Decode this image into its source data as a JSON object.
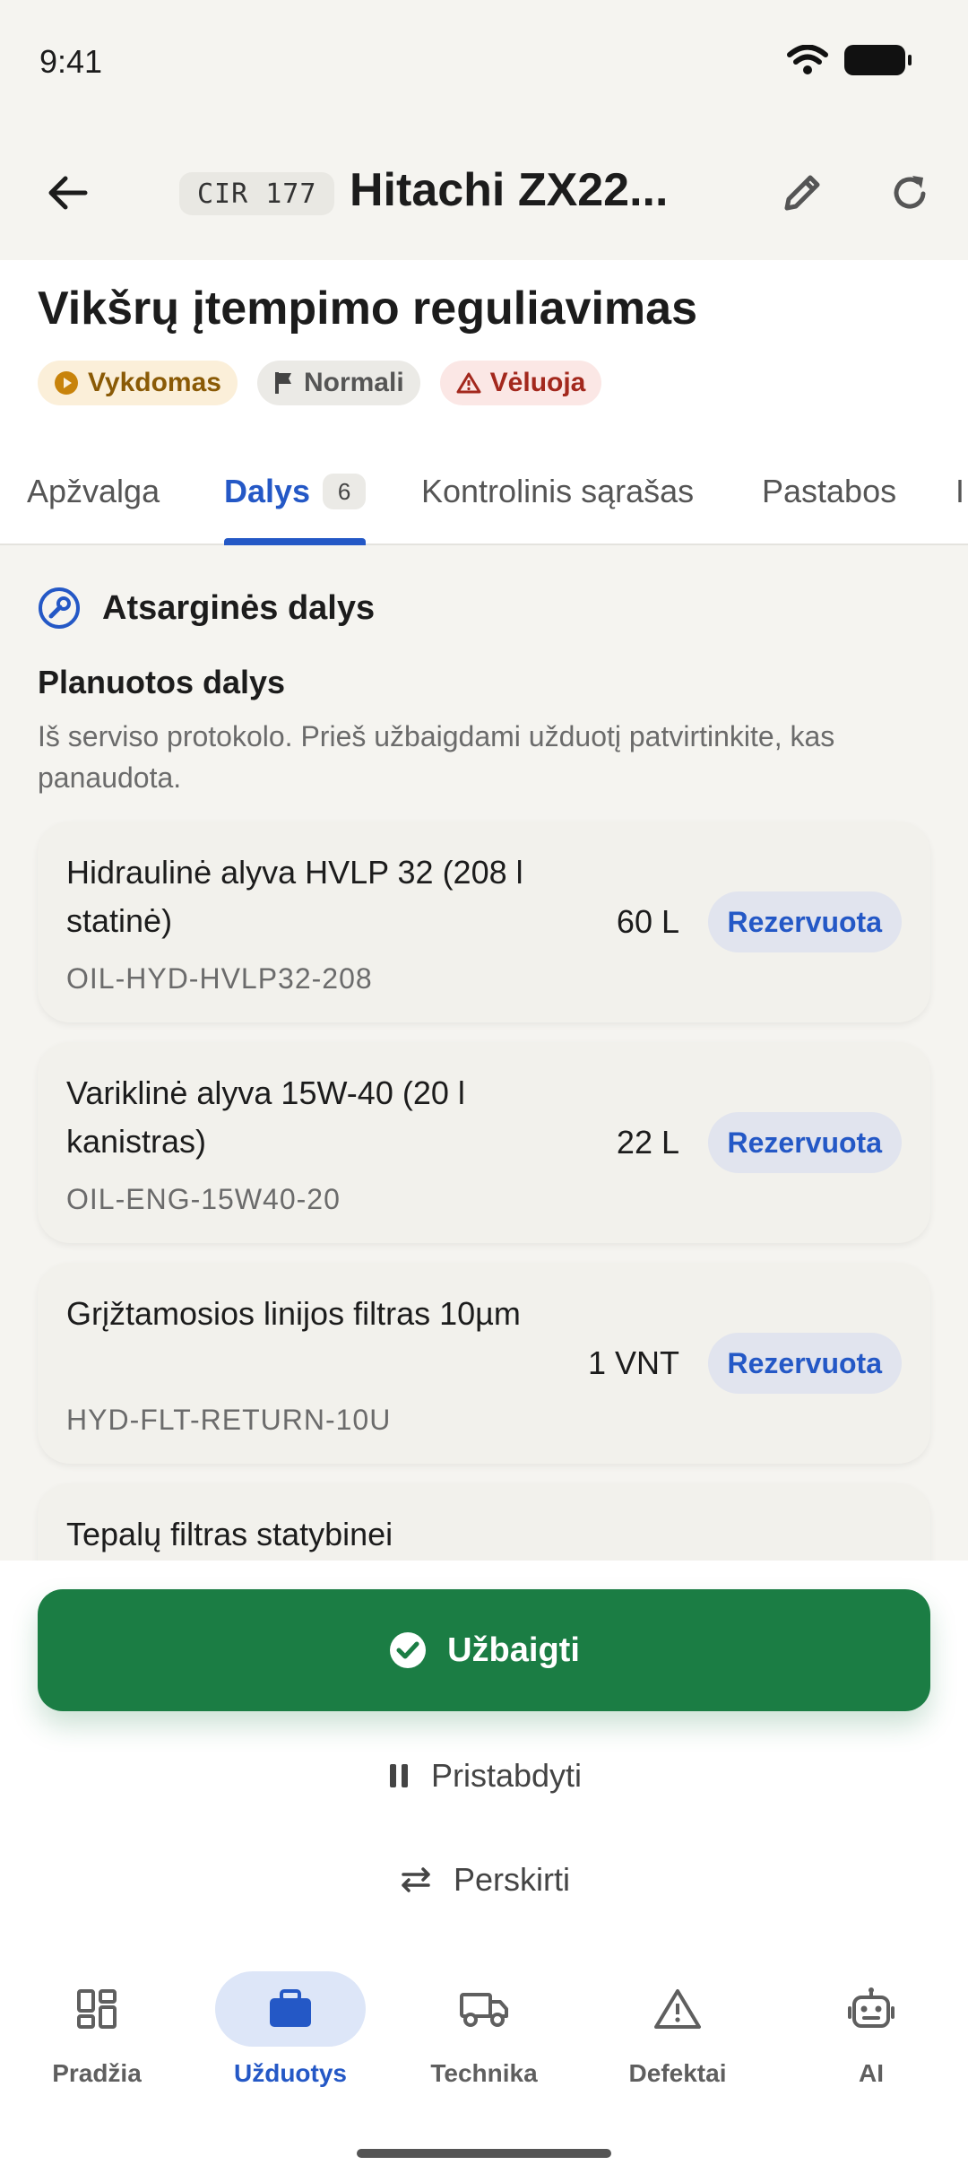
{
  "status_bar": {
    "time": "9:41"
  },
  "header": {
    "machine_code": "CIR 177",
    "machine_title": "Hitachi ZX22..."
  },
  "task": {
    "title": "Vikšrų įtempimo reguliavimas",
    "chips": {
      "status": "Vykdomas",
      "priority": "Normali",
      "late": "Vėluoja"
    }
  },
  "tabs": [
    {
      "label": "Apžvalga"
    },
    {
      "label": "Dalys",
      "count": "6"
    },
    {
      "label": "Kontrolinis sąrašas"
    },
    {
      "label": "Pastabos"
    },
    {
      "label": "I"
    }
  ],
  "parts_section": {
    "title": "Atsarginės dalys",
    "subtitle": "Planuotos dalys",
    "description": "Iš serviso protokolo. Prieš užbaigdami užduotį patvirtinkite, kas panaudota.",
    "items": [
      {
        "name": "Hidraulinė alyva HVLP 32 (208 l statinė)",
        "code": "OIL-HYD-HVLP32-208",
        "qty": "60 L",
        "status": "Rezervuota"
      },
      {
        "name": "Variklinė alyva 15W-40 (20 l kanistras)",
        "code": "OIL-ENG-15W40-20",
        "qty": "22 L",
        "status": "Rezervuota"
      },
      {
        "name": "Grįžtamosios linijos filtras 10µm",
        "code": "HYD-FLT-RETURN-10U",
        "qty": "1 VNT",
        "status": "Rezervuota"
      },
      {
        "name": "Tepalų filtras statybinei"
      }
    ]
  },
  "actions": {
    "complete": "Užbaigti",
    "pause": "Pristabdyti",
    "reassign": "Perskirti"
  },
  "bottom_nav": [
    {
      "label": "Pradžia",
      "icon": "dashboard-icon"
    },
    {
      "label": "Užduotys",
      "icon": "briefcase-icon",
      "active": true
    },
    {
      "label": "Technika",
      "icon": "truck-icon"
    },
    {
      "label": "Defektai",
      "icon": "warning-icon"
    },
    {
      "label": "AI",
      "icon": "robot-icon"
    }
  ],
  "colors": {
    "accent": "#2458c6",
    "success": "#1b7d44",
    "warning_bg": "#fbefd9",
    "danger_bg": "#fbe7e5"
  }
}
